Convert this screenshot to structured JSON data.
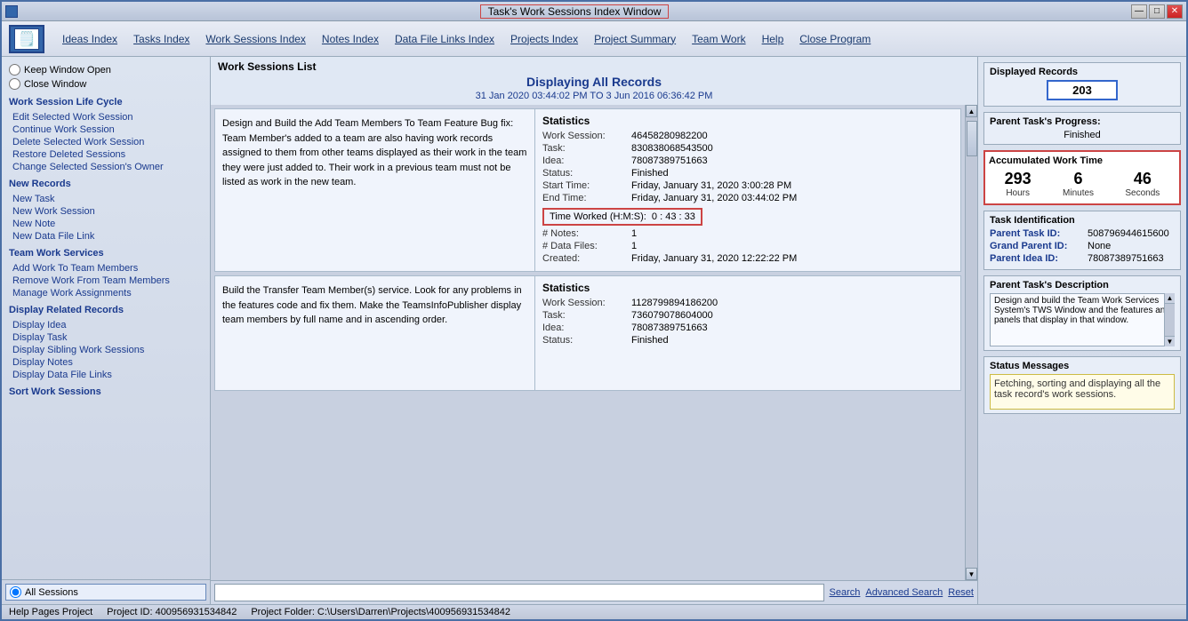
{
  "window": {
    "title": "Task's Work Sessions Index Window"
  },
  "titlebar": {
    "minimize": "—",
    "maximize": "□",
    "close": "✕"
  },
  "logo": {
    "icon": "📋"
  },
  "menu": {
    "items": [
      {
        "label": "Ideas Index",
        "id": "ideas-index"
      },
      {
        "label": "Tasks Index",
        "id": "tasks-index"
      },
      {
        "label": "Work Sessions Index",
        "id": "work-sessions-index"
      },
      {
        "label": "Notes Index",
        "id": "notes-index"
      },
      {
        "label": "Data File Links Index",
        "id": "data-file-links-index"
      },
      {
        "label": "Projects Index",
        "id": "projects-index"
      },
      {
        "label": "Project Summary",
        "id": "project-summary"
      },
      {
        "label": "Team Work",
        "id": "team-work"
      },
      {
        "label": "Help",
        "id": "help"
      },
      {
        "label": "Close Program",
        "id": "close-program"
      }
    ]
  },
  "sidebar": {
    "window_options": {
      "keep_open": "Keep Window Open",
      "close_window": "Close Window"
    },
    "sections": [
      {
        "title": "Work Session Life Cycle",
        "links": [
          "Edit Selected Work Session",
          "Continue Work Session",
          "Delete Selected Work Session",
          "Restore Deleted Sessions",
          "Change Selected Session's Owner"
        ]
      },
      {
        "title": "New Records",
        "links": [
          "New Task",
          "New Work Session",
          "New Note",
          "New Data File Link"
        ]
      },
      {
        "title": "Team Work Services",
        "links": [
          "Add Work To Team Members",
          "Remove Work From Team Members",
          "Manage Work Assignments"
        ]
      },
      {
        "title": "Display Related Records",
        "links": [
          "Display Idea",
          "Display Task",
          "Display Sibling Work Sessions",
          "Display Notes",
          "Display Data File Links"
        ]
      },
      {
        "title": "Sort Work Sessions",
        "links": []
      }
    ],
    "sort_option": "All Sessions"
  },
  "main": {
    "list_header": "Work Sessions List",
    "displaying_all": "Displaying All Records",
    "date_range": "31 Jan 2020   03:44:02 PM   TO   3 Jun 2016   06:36:42 PM",
    "records": [
      {
        "description": "Design and Build the Add Team Members To Team Feature Bug fix:\nTeam Member's added to a team are also having work records assigned to them from other teams displayed as their work in the team they were just added to. Their work in a previous team must not be listed as work in the new team.",
        "stats": {
          "work_session": "46458280982200",
          "task": "830838068543500",
          "idea": "78087389751663",
          "status": "Finished",
          "start_time": "Friday, January 31, 2020   3:00:28 PM",
          "end_time": "Friday, January 31, 2020   03:44:02 PM",
          "time_worked_label": "Time Worked (H:M:S):",
          "time_worked_value": "0  :  43  :  33",
          "notes": "1",
          "data_files": "1",
          "created": "Friday, January 31, 2020   12:22:22 PM"
        }
      },
      {
        "description": "Build the Transfer Team Member(s) service.\nLook for any problems in the features code and fix them.\nMake the TeamsInfoPublisher display team members by full name and in ascending order.",
        "stats": {
          "work_session": "11287998941862​00",
          "task": "736079078604000",
          "idea": "78087389751663",
          "status": "Finished",
          "start_time": "",
          "end_time": "",
          "time_worked_label": "",
          "time_worked_value": "",
          "notes": "",
          "data_files": "",
          "created": ""
        }
      }
    ]
  },
  "search_bar": {
    "placeholder": "",
    "search_label": "Search",
    "advanced_label": "Advanced Search",
    "reset_label": "Reset"
  },
  "right_panel": {
    "displayed_records": {
      "title": "Displayed Records",
      "value": "203"
    },
    "parent_progress": {
      "title": "Parent Task's Progress:",
      "value": "Finished"
    },
    "accumulated": {
      "title": "Accumulated Work Time",
      "hours": "293",
      "minutes": "6",
      "seconds": "46",
      "hours_label": "Hours",
      "minutes_label": "Minutes",
      "seconds_label": "Seconds"
    },
    "task_identification": {
      "title": "Task Identification",
      "parent_task_label": "Parent Task ID:",
      "parent_task_value": "508796944615600",
      "grand_parent_label": "Grand Parent ID:",
      "grand_parent_value": "None",
      "parent_idea_label": "Parent Idea ID:",
      "parent_idea_value": "78087389751663"
    },
    "parent_description": {
      "title": "Parent Task's Description",
      "value": "Design and build the Team Work Services System's TWS Window and the features and panels that display in that window."
    },
    "status_messages": {
      "title": "Status Messages",
      "value": "Fetching, sorting and displaying all the task record's work sessions."
    }
  },
  "status_bar": {
    "help_pages": "Help Pages Project",
    "project_id": "Project ID:  40095693​1534842",
    "project_folder": "Project Folder: C:\\Users\\Darren\\Projects\\400956931534842"
  }
}
